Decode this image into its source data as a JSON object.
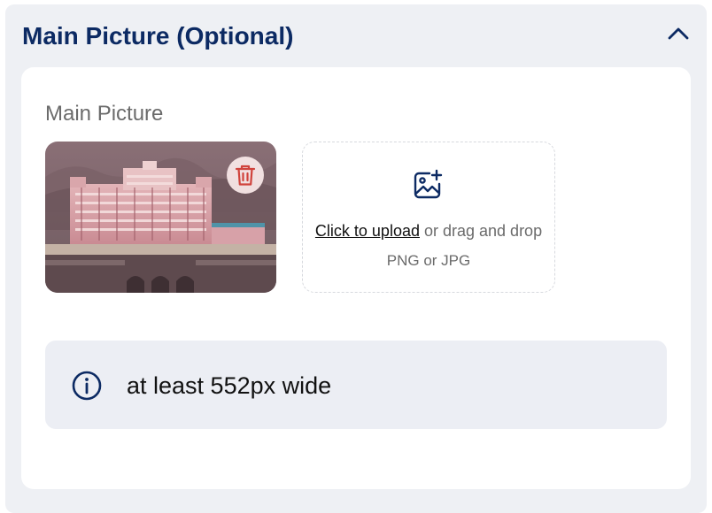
{
  "section": {
    "title": "Main Picture (Optional)",
    "collapse_icon": "chevron-up-icon"
  },
  "field": {
    "label": "Main Picture"
  },
  "thumbnail": {
    "alt": "Hotel facade image",
    "delete_icon": "trash-icon"
  },
  "upload": {
    "icon": "image-add-icon",
    "link_text": "Click to upload",
    "rest_text": " or drag and drop",
    "formats": "PNG or JPG"
  },
  "info": {
    "icon": "info-icon",
    "text": "at least 552px wide"
  },
  "colors": {
    "title": "#0c2a63",
    "delete": "#d0433c",
    "panel": "#eef0f4",
    "info_bg": "#eceef4"
  }
}
